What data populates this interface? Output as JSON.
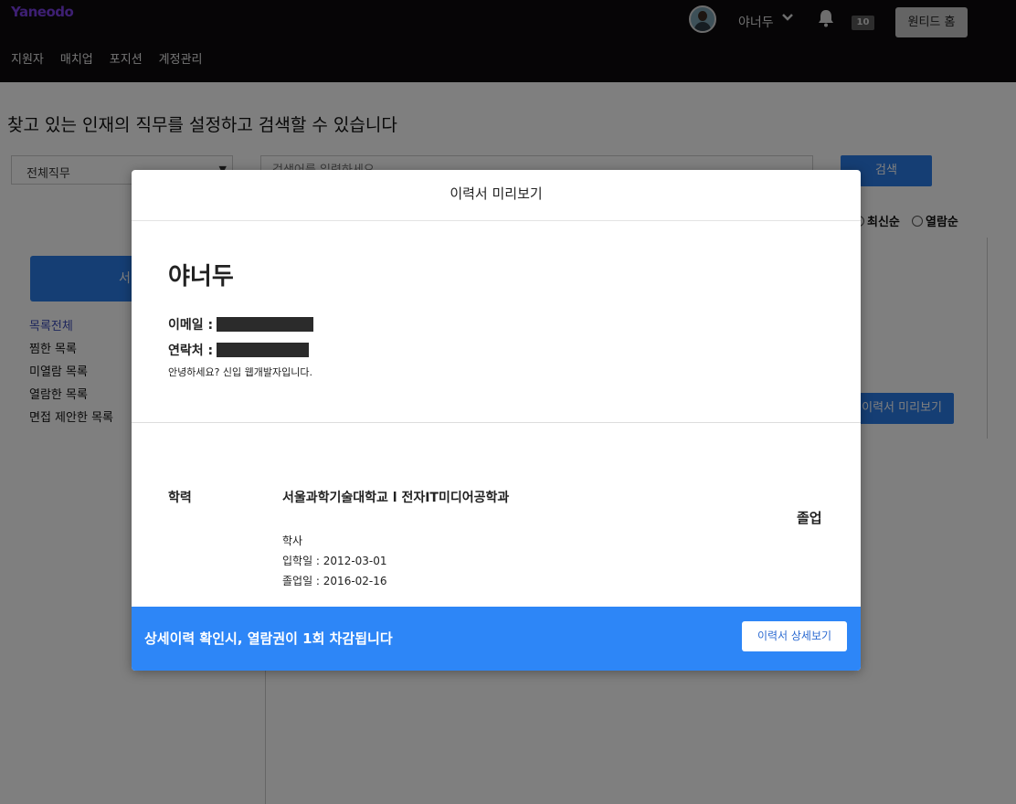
{
  "header": {
    "logo": "Yaneodo",
    "username": "야너두",
    "notification_count": "10",
    "home_button": "원티드 홈",
    "nav": [
      "지원자",
      "매치업",
      "포지션",
      "계정관리"
    ]
  },
  "main": {
    "title": "찾고 있는 인재의 직무를 설정하고 검색할 수 있습니다",
    "job_select": "전체직무",
    "search_placeholder": "검색어를 입력하세요",
    "search_button": "검색",
    "sort": [
      "최신순",
      "열람순"
    ],
    "service_button": "서비스 결",
    "sidebar": [
      "목록전체",
      "찜한 목록",
      "미열람 목록",
      "열람한 목록",
      "면접 제안한 목록"
    ],
    "preview_button": "이력서 미리보기"
  },
  "modal": {
    "title": "이력서 미리보기",
    "name": "야너두",
    "email_label": "이메일 :",
    "phone_label": "연락처 :",
    "intro": "안녕하세요? 신입 웹개발자입니다.",
    "education_label": "학력",
    "school": "서울과학기술대학교 l 전자IT미디어공학과",
    "degree": "학사",
    "admission": "입학일 : 2012-03-01",
    "graduation_date": "졸업일 : 2016-02-16",
    "status": "졸업",
    "footer_text": "상세이력 확인시, 열람권이 1회 차감됩니다",
    "detail_button": "이력서 상세보기"
  },
  "colors": {
    "accent": "#2b7de9",
    "footer": "#2d86f7",
    "topbar": "#0c0b0d",
    "logo": "#7b3fe4"
  }
}
